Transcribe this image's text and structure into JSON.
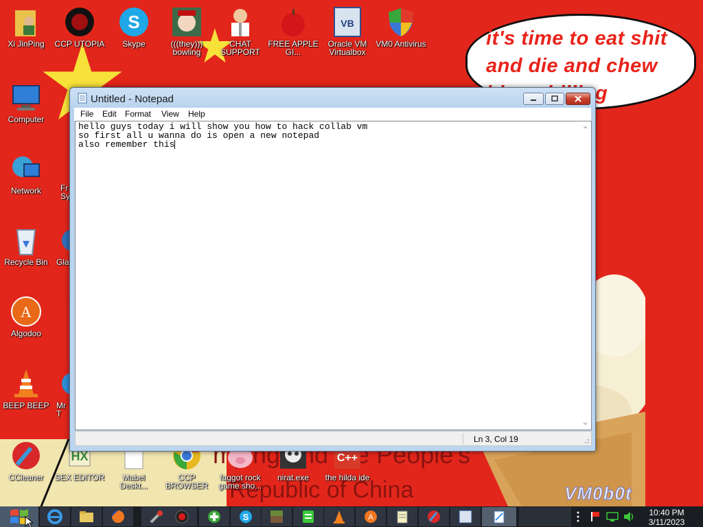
{
  "wallpaper": {
    "speech_bubble": "it's time to eat shit and die and chew bing chilling",
    "banner_line_1": "mping and the People's",
    "banner_line_2": "Republic of China",
    "watermark": "VM0b0t",
    "colors": {
      "background": "#e3261b",
      "star": "#f7e23a",
      "text": "#e8231a"
    }
  },
  "desktop_icons": [
    {
      "label": "Xi JinPing",
      "icon": "person-folder-icon"
    },
    {
      "label": "CCP UTOPIA",
      "icon": "dark-orb-icon"
    },
    {
      "label": "Skype",
      "icon": "skype-icon"
    },
    {
      "label": "(((they))) bowling",
      "icon": "santa-face-icon"
    },
    {
      "label": "CHAT SUPPORT",
      "icon": "doctor-icon"
    },
    {
      "label": "FREE APPLE GI...",
      "icon": "apple-icon"
    },
    {
      "label": "Oracle VM Virtualbox",
      "icon": "virtualbox-icon"
    },
    {
      "label": "VM0 Antivirus",
      "icon": "shield-icon"
    },
    {
      "label": "Computer",
      "icon": "computer-icon"
    },
    {
      "label": "Network",
      "icon": "network-icon"
    },
    {
      "label": "Recycle Bin",
      "icon": "recycle-bin-icon"
    },
    {
      "label": "Algodoo",
      "icon": "algodoo-icon"
    },
    {
      "label": "BEEP BEEP",
      "icon": "traffic-cone-icon"
    },
    {
      "label": "CCleaner",
      "icon": "ccleaner-icon"
    },
    {
      "label": "SEX EDITOR",
      "icon": "hex-editor-icon"
    },
    {
      "label": "Mabel Deskt...",
      "icon": "document-icon"
    },
    {
      "label": "CCP BROWSER",
      "icon": "chrome-icon"
    },
    {
      "label": "faggot rock game sho...",
      "icon": "pig-icon"
    },
    {
      "label": "nirat.exe",
      "icon": "skull-icon"
    },
    {
      "label": "the hilda ide",
      "icon": "cpp-icon"
    },
    {
      "label": "Fr Sy",
      "icon": "partial-icon"
    },
    {
      "label": "Gla",
      "icon": "partial-icon"
    },
    {
      "label": "Mr T",
      "icon": "partial-icon"
    }
  ],
  "notepad": {
    "title": "Untitled - Notepad",
    "menu": [
      "File",
      "Edit",
      "Format",
      "View",
      "Help"
    ],
    "text_line_1": "hello guys today i will show you how to hack collab vm",
    "text_line_2": "so first all u wanna do is open a new notepad",
    "text_line_3": "also remember this",
    "status_position": "Ln 3, Col 19"
  },
  "taskbar": {
    "apps": [
      "ie-icon",
      "folder-icon",
      "firefox-icon",
      "tool-icon",
      "record-icon",
      "game-icon",
      "skype-icon",
      "minecraft-icon",
      "app-icon",
      "vlc-icon",
      "avast-icon",
      "notepad-icon",
      "ccleaner-icon",
      "virtualbox-icon",
      "notepad-active-icon"
    ],
    "clock_time": "10:40 PM",
    "clock_date": "3/11/2023"
  }
}
